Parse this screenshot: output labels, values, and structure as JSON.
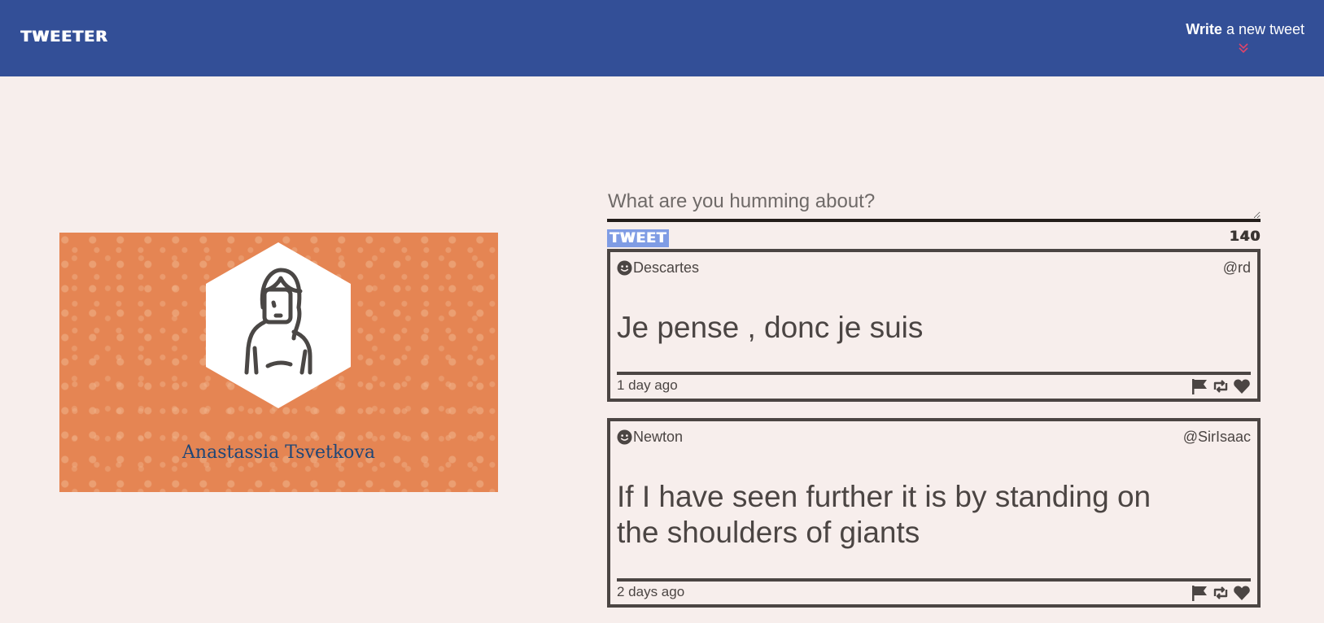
{
  "header": {
    "brand": "TWEETER",
    "compose_toggle_bold": "Write",
    "compose_toggle_rest": " a new tweet"
  },
  "profile": {
    "name": "Anastassia Tsvetkova"
  },
  "compose": {
    "placeholder": "What are you humming about?",
    "submit_label": "TWEET",
    "char_counter": "140"
  },
  "tweets": [
    {
      "author": "Descartes",
      "handle": "@rd",
      "text": "Je pense , donc je suis",
      "time": "1 day ago",
      "avatar_icon": "smiley-icon",
      "action_icons": [
        "flag-icon",
        "retweet-icon",
        "heart-icon"
      ]
    },
    {
      "author": "Newton",
      "handle": "@SirIsaac",
      "text": "If I have seen further it is by standing on the shoulders of giants",
      "time": "2 days ago",
      "avatar_icon": "smiley-icon",
      "action_icons": [
        "flag-icon",
        "retweet-icon",
        "heart-icon"
      ]
    }
  ],
  "colors": {
    "nav_bg": "#334f97",
    "page_bg": "#f7eeec",
    "profile_bg": "#e58553",
    "tweet_button_bg": "#7f9ce4",
    "name_color": "#1e4677",
    "chevron_color": "#e0446a"
  }
}
